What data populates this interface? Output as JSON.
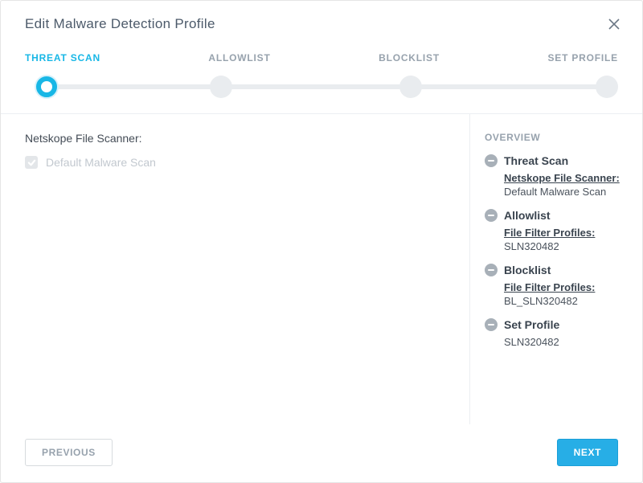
{
  "modal": {
    "title": "Edit Malware Detection Profile"
  },
  "stepper": {
    "steps": [
      "THREAT SCAN",
      "ALLOWLIST",
      "BLOCKLIST",
      "SET PROFILE"
    ]
  },
  "main": {
    "scanner_label": "Netskope File Scanner:",
    "default_scan_label": "Default Malware Scan"
  },
  "overview": {
    "title": "OVERVIEW",
    "items": [
      {
        "heading": "Threat Scan",
        "sublabel": "Netskope File Scanner:",
        "subvalue": "Default Malware Scan"
      },
      {
        "heading": "Allowlist",
        "sublabel": "File Filter Profiles:",
        "subvalue": "SLN320482"
      },
      {
        "heading": "Blocklist",
        "sublabel": "File Filter Profiles:",
        "subvalue": "BL_SLN320482"
      },
      {
        "heading": "Set Profile",
        "sublabel": "",
        "subvalue": "SLN320482"
      }
    ]
  },
  "footer": {
    "previous": "PREVIOUS",
    "next": "NEXT"
  }
}
